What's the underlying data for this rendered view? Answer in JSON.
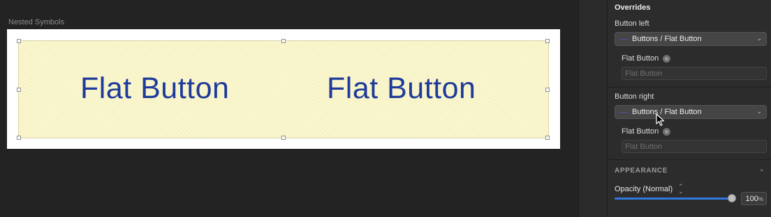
{
  "canvas": {
    "artboard_title": "Nested Symbols",
    "symbol": {
      "left_label": "Flat Button",
      "right_label": "Flat Button",
      "background_color": "#fbf7cf",
      "text_color": "#1e3a9a"
    }
  },
  "panel": {
    "overrides_title": "Overrides",
    "button_left": {
      "label": "Button left",
      "select_value": "Buttons / Flat Button",
      "sub_label": "Flat Button",
      "text_placeholder": "Flat Button"
    },
    "button_right": {
      "label": "Button right",
      "select_value": "Buttons / Flat Button",
      "sub_label": "Flat Button",
      "text_placeholder": "Flat Button"
    },
    "appearance": {
      "title": "APPEARANCE",
      "opacity_label": "Opacity (Normal)",
      "opacity_value": "100",
      "opacity_unit": "%",
      "opacity_fraction": 1.0
    }
  },
  "colors": {
    "accent": "#2f78e0",
    "panel_bg": "#2c2c2c",
    "canvas_bg": "#232323"
  },
  "icons": [
    "override-icon",
    "chevron-down-icon",
    "updown-stepper-icon",
    "mouse-pointer-icon"
  ]
}
